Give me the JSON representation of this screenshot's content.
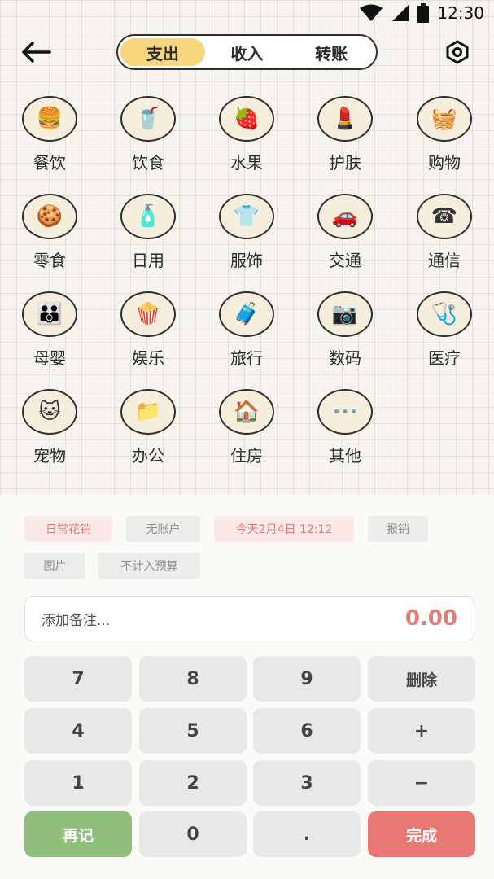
{
  "status_bar": {
    "time": "12:30"
  },
  "tabs": [
    {
      "label": "支出",
      "active": true
    },
    {
      "label": "收入",
      "active": false
    },
    {
      "label": "转账",
      "active": false
    }
  ],
  "categories": [
    {
      "label": "餐饮",
      "icon": "burger-icon",
      "glyph": "🍔"
    },
    {
      "label": "饮食",
      "icon": "drink-icon",
      "glyph": "🥤"
    },
    {
      "label": "水果",
      "icon": "strawberry-icon",
      "glyph": "🍓"
    },
    {
      "label": "护肤",
      "icon": "cosmetics-icon",
      "glyph": "💄"
    },
    {
      "label": "购物",
      "icon": "basket-icon",
      "glyph": "🧺"
    },
    {
      "label": "零食",
      "icon": "snack-icon",
      "glyph": "🍪"
    },
    {
      "label": "日用",
      "icon": "toiletries-icon",
      "glyph": "🧴"
    },
    {
      "label": "服饰",
      "icon": "clothes-icon",
      "glyph": "👕"
    },
    {
      "label": "交通",
      "icon": "car-icon",
      "glyph": "🚗"
    },
    {
      "label": "通信",
      "icon": "telephone-icon",
      "glyph": "☎"
    },
    {
      "label": "母婴",
      "icon": "mother-baby-icon",
      "glyph": "👪"
    },
    {
      "label": "娱乐",
      "icon": "popcorn-icon",
      "glyph": "🍿"
    },
    {
      "label": "旅行",
      "icon": "luggage-icon",
      "glyph": "🧳"
    },
    {
      "label": "数码",
      "icon": "camera-icon",
      "glyph": "📷"
    },
    {
      "label": "医疗",
      "icon": "medical-icon",
      "glyph": "🩺"
    },
    {
      "label": "宠物",
      "icon": "pets-icon",
      "glyph": "🐱"
    },
    {
      "label": "办公",
      "icon": "folders-icon",
      "glyph": "📁"
    },
    {
      "label": "住房",
      "icon": "house-icon",
      "glyph": "🏠"
    },
    {
      "label": "其他",
      "icon": "more-icon",
      "glyph": "•••"
    }
  ],
  "chips": {
    "daily": "日常花销",
    "account": "无账户",
    "date": "今天2月4日 12:12",
    "reimburse": "报销",
    "image": "图片",
    "budget": "不计入预算"
  },
  "remark": {
    "placeholder": "添加备注...",
    "amount": "0.00"
  },
  "keypad": {
    "k7": "7",
    "k8": "8",
    "k9": "9",
    "delete": "删除",
    "k4": "4",
    "k5": "5",
    "k6": "6",
    "plus": "+",
    "k1": "1",
    "k2": "2",
    "k3": "3",
    "minus": "−",
    "again": "再记",
    "k0": "0",
    "dot": ".",
    "done": "完成"
  },
  "colors": {
    "accent_yellow": "#f6d57c",
    "amount_red": "#e27c78",
    "done_red": "#e97773",
    "again_green": "#8fbf7a"
  }
}
